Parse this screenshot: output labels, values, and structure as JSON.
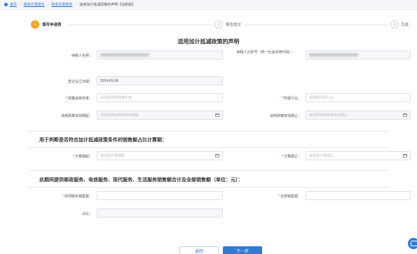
{
  "breadcrumb": {
    "home": "首页",
    "level1": "税收优惠报告",
    "level2": "税收优惠报告",
    "current": "适用加计抵减政策的声明【创新版】"
  },
  "steps": [
    {
      "num": "1",
      "label": "填写申请表"
    },
    {
      "num": "2",
      "label": "预览提交"
    },
    {
      "num": "3",
      "label": "完成"
    }
  ],
  "form_title": "适用加计抵减政策的声明",
  "fields": {
    "taxpayer_name": {
      "label": "纳税人名称："
    },
    "taxpayer_id": {
      "label": "纳税人识别号（统一社会信用代码）："
    },
    "reg_date": {
      "label": "登记设立日期：",
      "value": "2014-01-24"
    },
    "policy_type": {
      "label": "政策适用年度：",
      "placeholder": "请选择适用政策年度"
    },
    "industry": {
      "label": "所属行业：",
      "placeholder": "请选择所属行业"
    },
    "start_period": {
      "label": "适用政策有效期起：",
      "placeholder": "请选择适用政策有效期起"
    },
    "end_period": {
      "label": "适用政策有效期止：",
      "placeholder": "请选择适用政策有效期止"
    }
  },
  "section1": {
    "title": "用于判断是否符合加计抵减政策条件的销售额占比计算期：",
    "calc_start": {
      "label": "计算期起：",
      "placeholder": "请选择计算期起"
    },
    "calc_end": {
      "label": "计算期止：",
      "placeholder": "请选择计算期止"
    }
  },
  "section2": {
    "title": "此期间提供邮政服务、电信服务、现代服务、生活服务销售额合计及全部销售额（单位：元）：",
    "service_sales": {
      "label": "四项服务销售额："
    },
    "total_sales": {
      "label": "全部销售额："
    },
    "ratio": {
      "label": "占比："
    }
  },
  "buttons": {
    "prev": "返回",
    "next": "下一步"
  },
  "colors": {
    "primary": "#2f7bd6",
    "step_active": "#f5a623",
    "required": "#e02020"
  }
}
